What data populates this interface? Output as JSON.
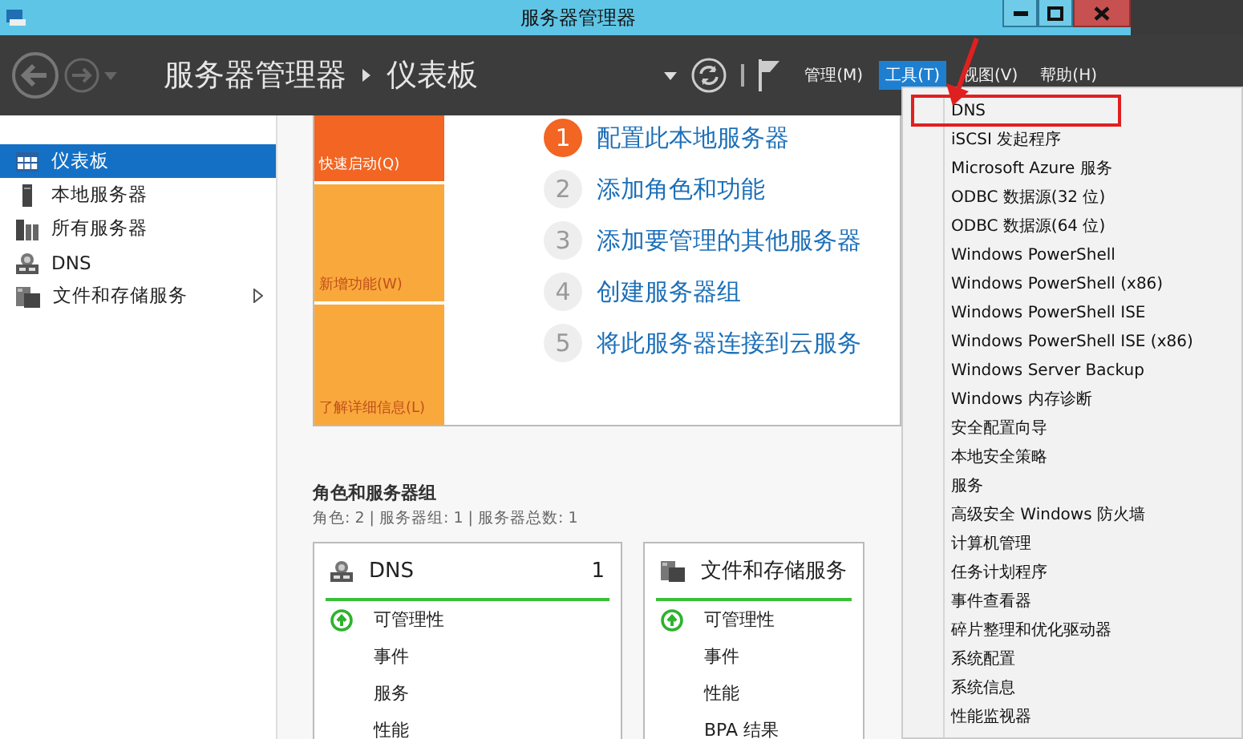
{
  "window": {
    "title": "服务器管理器"
  },
  "header": {
    "breadcrumb": [
      "服务器管理器",
      "仪表板"
    ],
    "menus": [
      {
        "label": "管理(M)",
        "selected": false
      },
      {
        "label": "工具(T)",
        "selected": true
      },
      {
        "label": "视图(V)",
        "selected": false
      },
      {
        "label": "帮助(H)",
        "selected": false
      }
    ]
  },
  "sidebar": {
    "items": [
      {
        "label": "仪表板",
        "kind": "dashboard",
        "selected": true,
        "expandable": false
      },
      {
        "label": "本地服务器",
        "kind": "server",
        "selected": false,
        "expandable": false
      },
      {
        "label": "所有服务器",
        "kind": "servers",
        "selected": false,
        "expandable": false
      },
      {
        "label": "DNS",
        "kind": "role",
        "selected": false,
        "expandable": false
      },
      {
        "label": "文件和存储服务",
        "kind": "storage",
        "selected": false,
        "expandable": true
      }
    ]
  },
  "quick_start": {
    "tiles": [
      {
        "label": "快速启动(Q)",
        "selected": true
      },
      {
        "label": "新增功能(W)",
        "selected": false
      },
      {
        "label": "了解详细信息(L)",
        "selected": false
      }
    ],
    "steps": [
      {
        "number": "1",
        "label": "配置此本地服务器",
        "current": true
      },
      {
        "number": "2",
        "label": "添加角色和功能",
        "current": false
      },
      {
        "number": "3",
        "label": "添加要管理的其他服务器",
        "current": false
      },
      {
        "number": "4",
        "label": "创建服务器组",
        "current": false
      },
      {
        "number": "5",
        "label": "将此服务器连接到云服务",
        "current": false
      }
    ]
  },
  "roles": {
    "title": "角色和服务器组",
    "summary": "角色: 2 | 服务器组: 1 | 服务器总数: 1",
    "cards": [
      {
        "title": "DNS",
        "kind": "role",
        "count": "1",
        "rows": [
          {
            "label": "可管理性",
            "ok": true
          },
          {
            "label": "事件",
            "ok": false
          },
          {
            "label": "服务",
            "ok": false
          },
          {
            "label": "性能",
            "ok": false
          }
        ]
      },
      {
        "title": "文件和存储服务",
        "kind": "storage",
        "rows": [
          {
            "label": "可管理性",
            "ok": true
          },
          {
            "label": "事件",
            "ok": false
          },
          {
            "label": "性能",
            "ok": false
          },
          {
            "label": "BPA 结果",
            "ok": false
          }
        ]
      }
    ]
  },
  "tools_menu": {
    "items": [
      {
        "label": "DNS",
        "highlighted": true
      },
      {
        "label": "iSCSI 发起程序",
        "highlighted": false
      },
      {
        "label": "Microsoft Azure 服务",
        "highlighted": false
      },
      {
        "label": "ODBC 数据源(32 位)",
        "highlighted": false
      },
      {
        "label": "ODBC 数据源(64 位)",
        "highlighted": false
      },
      {
        "label": "Windows PowerShell",
        "highlighted": false
      },
      {
        "label": "Windows PowerShell (x86)",
        "highlighted": false
      },
      {
        "label": "Windows PowerShell ISE",
        "highlighted": false
      },
      {
        "label": "Windows PowerShell ISE (x86)",
        "highlighted": false
      },
      {
        "label": "Windows Server Backup",
        "highlighted": false
      },
      {
        "label": "Windows 内存诊断",
        "highlighted": false
      },
      {
        "label": "安全配置向导",
        "highlighted": false
      },
      {
        "label": "本地安全策略",
        "highlighted": false
      },
      {
        "label": "服务",
        "highlighted": false
      },
      {
        "label": "高级安全 Windows 防火墙",
        "highlighted": false
      },
      {
        "label": "计算机管理",
        "highlighted": false
      },
      {
        "label": "任务计划程序",
        "highlighted": false
      },
      {
        "label": "事件查看器",
        "highlighted": false
      },
      {
        "label": "碎片整理和优化驱动器",
        "highlighted": false
      },
      {
        "label": "系统配置",
        "highlighted": false
      },
      {
        "label": "系统信息",
        "highlighted": false
      },
      {
        "label": "性能监视器",
        "highlighted": false
      }
    ]
  }
}
